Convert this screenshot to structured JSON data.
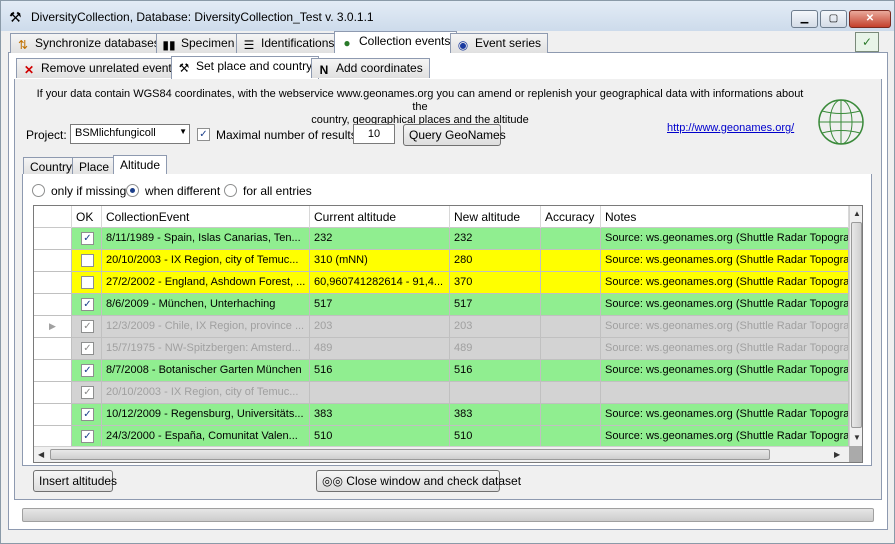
{
  "window": {
    "title": "DiversityCollection,  Database: DiversityCollection_Test    v. 3.0.1.1",
    "icon": "tools-icon"
  },
  "main_tabs": [
    {
      "label": "Synchronize databases",
      "icon": "sync-icon"
    },
    {
      "label": "Specimen",
      "icon": "barcode-icon"
    },
    {
      "label": "Identifications",
      "icon": "list-icon"
    },
    {
      "label": "Collection events",
      "icon": "globe-icon"
    },
    {
      "label": "Event series",
      "icon": "globe-series-icon"
    }
  ],
  "sub_tabs": [
    {
      "label": "Remove unrelated events",
      "icon": "red-x-icon"
    },
    {
      "label": "Set place and country",
      "icon": "tools-icon"
    },
    {
      "label": "Add coordinates",
      "icon": "north-icon"
    }
  ],
  "info_text_line1": "If your data contain WGS84 coordinates, with the webservice www.geonames.org you can amend or replenish your geographical data with informations about the",
  "info_text_line2": "country,  geographical places and the altitude",
  "geonames_link": "http://www.geonames.org/",
  "project": {
    "label": "Project:",
    "value": "BSMlichfungicoll"
  },
  "max_results": {
    "label": "Maximal number of results:",
    "checked": true,
    "value": "10"
  },
  "query_button": "Query GeoNames",
  "detail_tabs": [
    "Country",
    "Place",
    "Altitude"
  ],
  "radios": [
    {
      "label": "only if missing",
      "selected": false
    },
    {
      "label": "when different",
      "selected": true
    },
    {
      "label": "for all entries",
      "selected": false
    }
  ],
  "grid": {
    "columns": [
      "OK",
      "CollectionEvent",
      "Current altitude",
      "New altitude",
      "Accuracy",
      "Notes"
    ],
    "rows": [
      {
        "status": "green",
        "ok": true,
        "event": "8/11/1989 - Spain, Islas Canarias, Ten...",
        "current": "232",
        "new": "232",
        "accuracy": "",
        "notes": "Source: ws.geonames.org (Shuttle Radar Topography"
      },
      {
        "status": "yellow",
        "ok": false,
        "event": "20/10/2003 - IX Region, city of Temuc...",
        "current": "310 (mNN)",
        "new": "280",
        "accuracy": "",
        "notes": "Source: ws.geonames.org (Shuttle Radar Topography"
      },
      {
        "status": "yellow",
        "ok": false,
        "event": "27/2/2002 - England, Ashdown Forest, ...",
        "current": "60,960741282614 - 91,4...",
        "new": "370",
        "accuracy": "",
        "notes": "Source: ws.geonames.org (Shuttle Radar Topography"
      },
      {
        "status": "green",
        "ok": true,
        "event": "8/6/2009 - München, Unterhaching",
        "current": "517",
        "new": "517",
        "accuracy": "",
        "notes": "Source: ws.geonames.org (Shuttle Radar Topography"
      },
      {
        "status": "gray",
        "ok": true,
        "event": "12/3/2009 - Chile, IX Region, province ...",
        "current": "203",
        "new": "203",
        "accuracy": "",
        "notes": "Source: ws.geonames.org (Shuttle Radar Topography",
        "current_row": true
      },
      {
        "status": "gray",
        "ok": true,
        "event": "15/7/1975 - NW-Spitzbergen: Amsterd...",
        "current": "489",
        "new": "489",
        "accuracy": "",
        "notes": "Source: ws.geonames.org (Shuttle Radar Topography"
      },
      {
        "status": "green",
        "ok": true,
        "event": "8/7/2008 - Botanischer Garten München",
        "current": "516",
        "new": "516",
        "accuracy": "",
        "notes": "Source: ws.geonames.org (Shuttle Radar Topography"
      },
      {
        "status": "gray",
        "ok": true,
        "event": "20/10/2003 - IX Region, city of Temuc...",
        "current": "",
        "new": "",
        "accuracy": "",
        "notes": ""
      },
      {
        "status": "green",
        "ok": true,
        "event": "10/12/2009 - Regensburg, Universitäts...",
        "current": "383",
        "new": "383",
        "accuracy": "",
        "notes": "Source: ws.geonames.org (Shuttle Radar Topography"
      },
      {
        "status": "green",
        "ok": true,
        "event": "24/3/2000 - España, Comunitat Valen...",
        "current": "510",
        "new": "510",
        "accuracy": "",
        "notes": "Source: ws.geonames.org (Shuttle Radar Topography"
      }
    ]
  },
  "insert_button": "Insert altitudes",
  "close_button": {
    "label": "Close window and check dataset",
    "icon": "binoculars-icon"
  }
}
